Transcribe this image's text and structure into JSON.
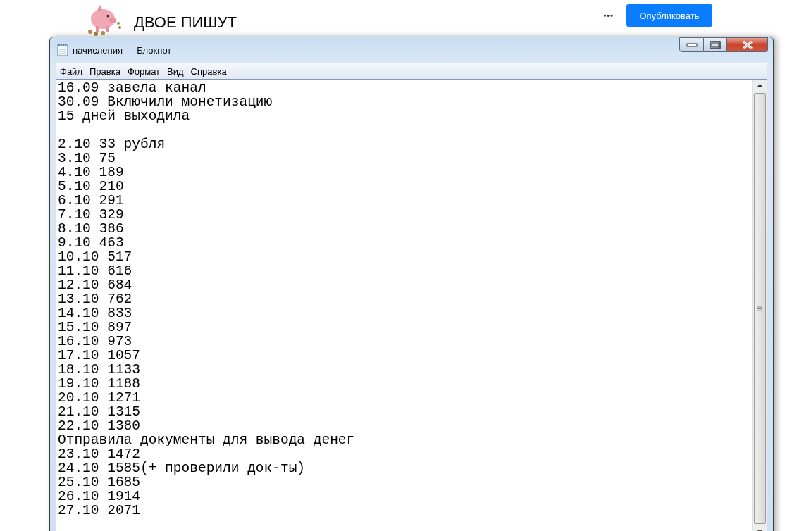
{
  "header": {
    "title": "ДВОЕ ПИШУТ",
    "more": "•••",
    "publish_button": "Опубликовать"
  },
  "window": {
    "title": "начисления — Блокнот"
  },
  "menu": [
    "Файл",
    "Правка",
    "Формат",
    "Вид",
    "Справка"
  ],
  "text_blocks": [
    [
      "16.09 завела канал",
      "30.09 Включили монетизацию",
      "15 дней выходила"
    ],
    [
      "2.10 33 рубля",
      "3.10 75",
      "4.10 189",
      "5.10 210",
      "6.10 291",
      "7.10 329",
      "8.10 386",
      "9.10 463",
      "10.10 517",
      "11.10 616",
      "12.10 684",
      "13.10 762",
      "14.10 833",
      "15.10 897",
      "16.10 973",
      "17.10 1057",
      "18.10 1133",
      "19.10 1188",
      "20.10 1271",
      "21.10 1315",
      "22.10 1380",
      "Отправила документы для вывода денег",
      "23.10 1472",
      "24.10 1585(+ проверили док-ты)",
      "25.10 1685",
      "26.10 1914",
      "27.10 2071"
    ]
  ]
}
